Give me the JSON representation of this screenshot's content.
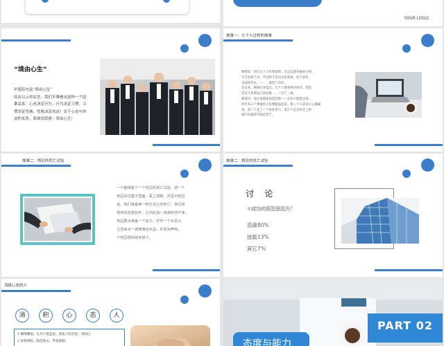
{
  "slides": {
    "s1": {},
    "s2": {
      "logo": "YOUR LOGO"
    },
    "s3": {
      "title": "“境由心生”",
      "lines": [
        "中国有句话“境由心生”",
        "综合以上的名言，我们不难看出这样一个因",
        "果关系：心态决定行为，行为决定习惯，习",
        "惯决定性格，性格决定命运！关于心态与命",
        "运的关系，简单说就是：境由心生！"
      ]
    },
    "s4": {
      "label": "故事一：九个人过桥的故事",
      "lines": [
        "教授说：你们九个人听我指挥，走过这座弯曲的小桥，",
        "千万别掉下去，不过掉下去也没有关系，底下就有",
        "浅浅的河水，一……都到了对岸。",
        "走过去。教授打开电灯，九个人看到桥水很深，而且",
        "还有几条鳄鱼在游动着……一切了一眼。",
        "教授问：现在谁愿意再走回来一一没有人愿意出来。",
        "终于有三个勇敢的人犹豫着站起来，第一个人非常小心翼翼",
        "地，第二个变了一个样的步行，第三个这没有走上桥",
        "就吓趴着爬不能走到了。"
      ]
    },
    "s5": {
      "label": "故事二：残忍的死亡试验",
      "lines": [
        "一个教授做了一个残忍的死亡试验。把一个",
        "死囚关在屋子里面，蒙上双眼，并且对死囚",
        "说，我们准备换一种方法让你死亡，我们将",
        "把你的血管割开，让你的血一滴滴的流干净。",
        "死囚要点准备一个盆子，拧开一个水龙头",
        "让自来水一滴滴滴进水盆，并发出声响。",
        "个死囚很快就死掉了。"
      ]
    },
    "s6": {
      "label": "故事二：残忍的死亡试验",
      "title": "讨    论",
      "question": "①成功的原因是因为？",
      "items": [
        "态度80%",
        "技能13%",
        "其它7%"
      ]
    },
    "s7": {
      "label": "消极心态的人",
      "chars": [
        "消",
        "积",
        "心",
        "态",
        "人"
      ],
      "lines": [
        "1.懒惰懒怕。认为人性丑恶。厌恶人际交往：《刺文》",
        "2.没有目标。缺乏动力。不思进取；"
      ]
    },
    "s8": {
      "part": "PART 02",
      "title": "态度与能力"
    }
  },
  "colors": {
    "accent": "#3a7dc9",
    "light": "#7fb2e6"
  }
}
